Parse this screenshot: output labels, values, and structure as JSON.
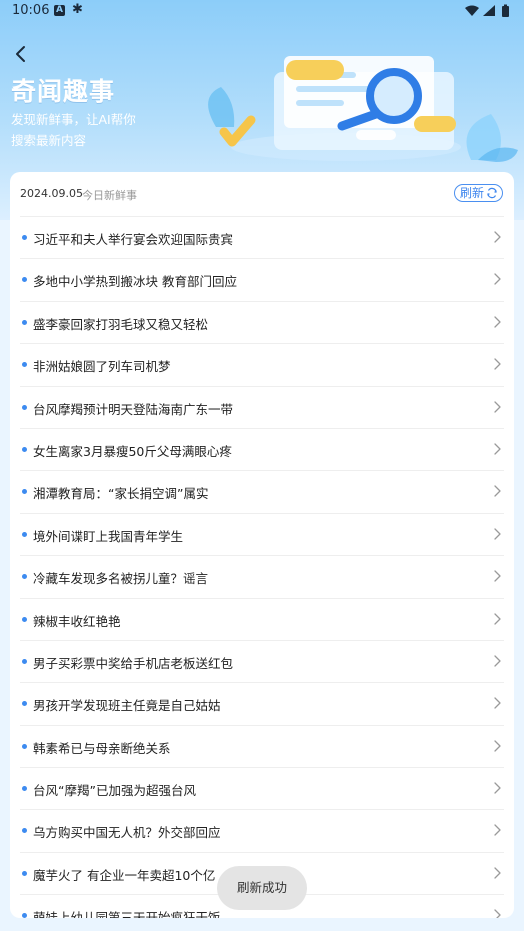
{
  "status_bar": {
    "time": "10:06"
  },
  "header": {
    "title": "奇闻趣事",
    "subtitle": "发现新鲜事，让AI帮你搜索最新内容"
  },
  "card": {
    "date": "2024.09.05",
    "daily_label": "今日新鲜事",
    "refresh_label": "刷新"
  },
  "news": [
    {
      "title": "习近平和夫人举行宴会欢迎国际贵宾"
    },
    {
      "title": "多地中小学热到搬冰块 教育部门回应"
    },
    {
      "title": "盛李豪回家打羽毛球又稳又轻松"
    },
    {
      "title": "非洲姑娘圆了列车司机梦"
    },
    {
      "title": "台风摩羯预计明天登陆海南广东一带"
    },
    {
      "title": "女生离家3月暴瘦50斤父母满眼心疼"
    },
    {
      "title": "湘潭教育局：“家长捐空调”属实"
    },
    {
      "title": "境外间谍盯上我国青年学生"
    },
    {
      "title": "冷藏车发现多名被拐儿童？谣言"
    },
    {
      "title": "辣椒丰收红艳艳"
    },
    {
      "title": "男子买彩票中奖给手机店老板送红包"
    },
    {
      "title": "男孩开学发现班主任竟是自己姑姑"
    },
    {
      "title": "韩素希已与母亲断绝关系"
    },
    {
      "title": "台风“摩羯”已加强为超强台风"
    },
    {
      "title": "乌方购买中国无人机？外交部回应"
    },
    {
      "title": "魔芋火了 有企业一年卖超10个亿"
    },
    {
      "title": "萌娃上幼儿园第三天开始疯狂干饭"
    }
  ],
  "toast": {
    "message": "刷新成功"
  },
  "colors": {
    "accent": "#3d8bf0",
    "hero_top": "#8ccdf9"
  },
  "icons": [
    "back-arrow-icon",
    "refresh-icon",
    "chevron-right-icon",
    "wifi-icon",
    "signal-icon",
    "battery-icon",
    "search-magnifier-icon"
  ]
}
